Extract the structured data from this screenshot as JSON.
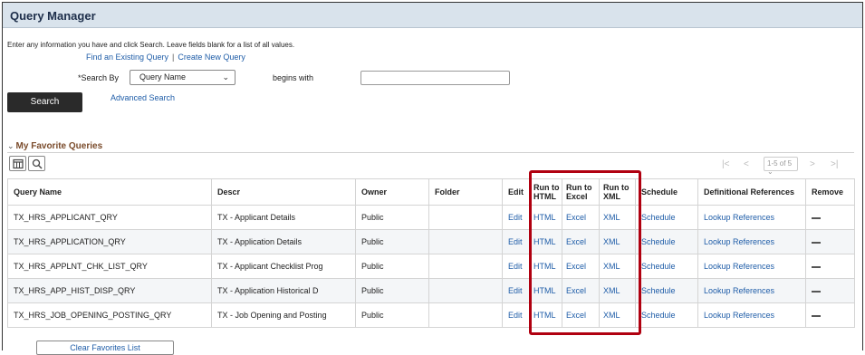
{
  "title": "Query Manager",
  "instructions": "Enter any information you have and click Search. Leave fields blank for a list of all values.",
  "links": {
    "find_existing": "Find an Existing Query",
    "separator": "|",
    "create_new": "Create New Query"
  },
  "search": {
    "search_by_label": "*Search By",
    "search_by_value": "Query Name",
    "begins_with_label": "begins with",
    "begins_with_value": "",
    "search_button": "Search",
    "advanced_search": "Advanced Search"
  },
  "favorites": {
    "header": "My Favorite Queries",
    "pager": {
      "first": "|<",
      "prev": "<",
      "range": "1-5 of 5",
      "next": ">",
      "last": ">|"
    },
    "columns": {
      "query_name": "Query Name",
      "descr": "Descr",
      "owner": "Owner",
      "folder": "Folder",
      "edit": "Edit",
      "run_html": "Run to HTML",
      "run_excel": "Run to Excel",
      "run_xml": "Run to XML",
      "schedule": "Schedule",
      "def_refs": "Definitional References",
      "remove": "Remove"
    },
    "rows": [
      {
        "query_name": "TX_HRS_APPLICANT_QRY",
        "descr": "TX - Applicant Details",
        "owner": "Public",
        "folder": "",
        "edit": "Edit",
        "html": "HTML",
        "excel": "Excel",
        "xml": "XML",
        "schedule": "Schedule",
        "refs": "Lookup References"
      },
      {
        "query_name": "TX_HRS_APPLICATION_QRY",
        "descr": "TX - Application Details",
        "owner": "Public",
        "folder": "",
        "edit": "Edit",
        "html": "HTML",
        "excel": "Excel",
        "xml": "XML",
        "schedule": "Schedule",
        "refs": "Lookup References"
      },
      {
        "query_name": "TX_HRS_APPLNT_CHK_LIST_QRY",
        "descr": "TX - Applicant Checklist Prog",
        "owner": "Public",
        "folder": "",
        "edit": "Edit",
        "html": "HTML",
        "excel": "Excel",
        "xml": "XML",
        "schedule": "Schedule",
        "refs": "Lookup References"
      },
      {
        "query_name": "TX_HRS_APP_HIST_DISP_QRY",
        "descr": "TX - Application Historical D",
        "owner": "Public",
        "folder": "",
        "edit": "Edit",
        "html": "HTML",
        "excel": "Excel",
        "xml": "XML",
        "schedule": "Schedule",
        "refs": "Lookup References"
      },
      {
        "query_name": "TX_HRS_JOB_OPENING_POSTING_QRY",
        "descr": "TX - Job Opening and Posting",
        "owner": "Public",
        "folder": "",
        "edit": "Edit",
        "html": "HTML",
        "excel": "Excel",
        "xml": "XML",
        "schedule": "Schedule",
        "refs": "Lookup References"
      }
    ],
    "clear_button": "Clear Favorites List"
  },
  "colors": {
    "title_bar": "#d9e3ec",
    "link": "#1f5da8",
    "highlight": "#b00010",
    "section_header": "#7a4b2b"
  }
}
